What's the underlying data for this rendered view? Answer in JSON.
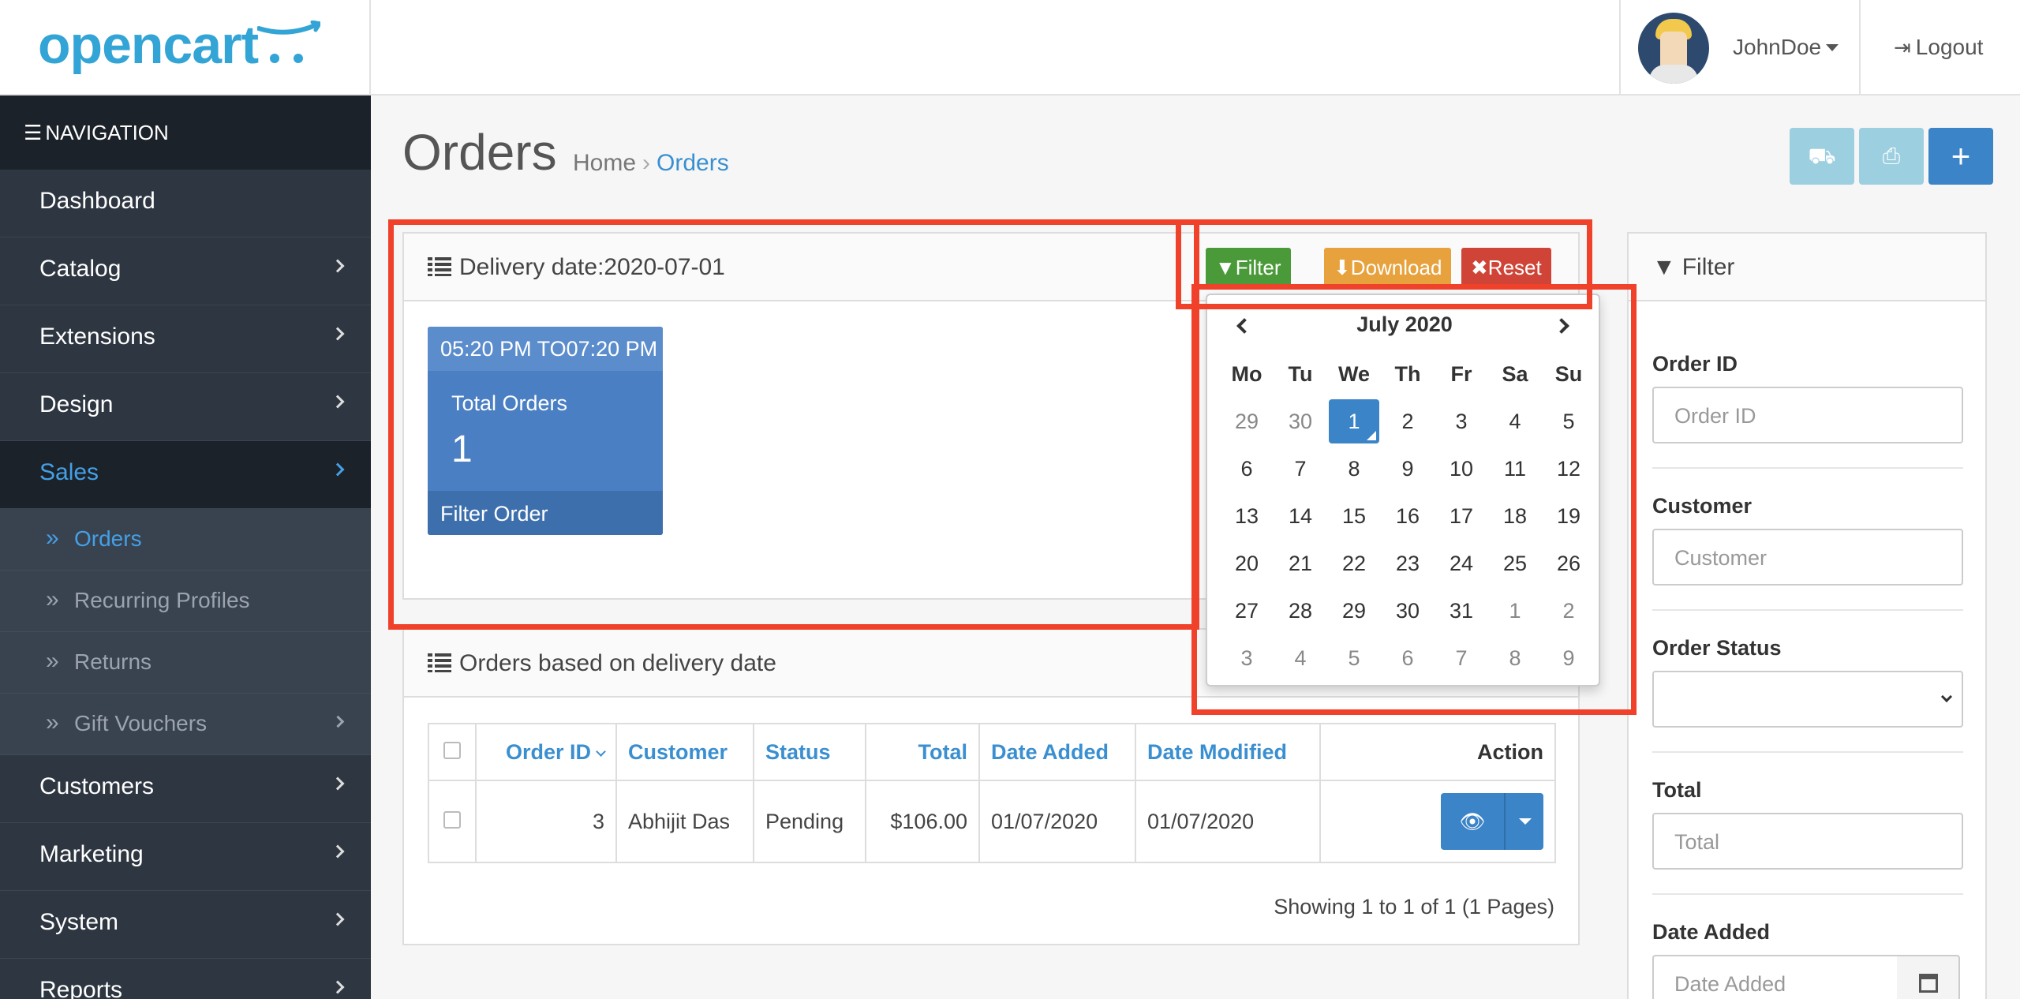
{
  "brand": {
    "logo_text": "opencart"
  },
  "user": {
    "name": "JohnDoe",
    "logout_label": "Logout"
  },
  "nav": {
    "heading": "NAVIGATION",
    "items": [
      {
        "label": "Dashboard"
      },
      {
        "label": "Catalog"
      },
      {
        "label": "Extensions"
      },
      {
        "label": "Design"
      },
      {
        "label": "Sales"
      }
    ],
    "sales_sub": [
      {
        "label": "Orders"
      },
      {
        "label": "Recurring Profiles"
      },
      {
        "label": "Returns"
      },
      {
        "label": "Gift Vouchers"
      }
    ],
    "items_after": [
      {
        "label": "Customers"
      },
      {
        "label": "Marketing"
      },
      {
        "label": "System"
      },
      {
        "label": "Reports"
      }
    ]
  },
  "page": {
    "title": "Orders",
    "breadcrumb": [
      "Home",
      "Orders"
    ]
  },
  "delivery_panel": {
    "title": "Delivery date:2020-07-01",
    "filter_label": "Filter",
    "download_label": "Download",
    "reset_label": "Reset",
    "card": {
      "time_range": "05:20 PM TO07:20 PM",
      "label": "Total Orders",
      "count": "1",
      "footer": "Filter Order"
    }
  },
  "datepicker": {
    "title": "July 2020",
    "weekdays": [
      "Mo",
      "Tu",
      "We",
      "Th",
      "Fr",
      "Sa",
      "Su"
    ],
    "weeks": [
      [
        "29",
        "30",
        "1",
        "2",
        "3",
        "4",
        "5"
      ],
      [
        "6",
        "7",
        "8",
        "9",
        "10",
        "11",
        "12"
      ],
      [
        "13",
        "14",
        "15",
        "16",
        "17",
        "18",
        "19"
      ],
      [
        "20",
        "21",
        "22",
        "23",
        "24",
        "25",
        "26"
      ],
      [
        "27",
        "28",
        "29",
        "30",
        "31",
        "1",
        "2"
      ],
      [
        "3",
        "4",
        "5",
        "6",
        "7",
        "8",
        "9"
      ]
    ],
    "selected": "1"
  },
  "orders_panel": {
    "title": "Orders based on delivery date",
    "columns": {
      "order_id": "Order ID",
      "customer": "Customer",
      "status": "Status",
      "total": "Total",
      "date_added": "Date Added",
      "date_modified": "Date Modified",
      "action": "Action"
    },
    "rows": [
      {
        "order_id": "3",
        "customer": "Abhijit Das",
        "status": "Pending",
        "total": "$106.00",
        "date_added": "01/07/2020",
        "date_modified": "01/07/2020"
      }
    ],
    "pagination": "Showing 1 to 1 of 1 (1 Pages)"
  },
  "filter_panel": {
    "title": "Filter",
    "order_id": {
      "label": "Order ID",
      "placeholder": "Order ID"
    },
    "customer": {
      "label": "Customer",
      "placeholder": "Customer"
    },
    "order_status": {
      "label": "Order Status",
      "value": ""
    },
    "total": {
      "label": "Total",
      "placeholder": "Total"
    },
    "date_added": {
      "label": "Date Added",
      "placeholder": "Date Added"
    }
  },
  "colors": {
    "accent_blue": "#3c84c8",
    "sidebar_bg": "#2e3641",
    "filter_green": "#4b9a3a",
    "download_orange": "#e7a23d",
    "reset_red": "#cf4436",
    "highlight_red": "#f0412b",
    "logo_blue": "#33a4d6"
  },
  "icons": {
    "menu": "bars-icon",
    "logout": "sign-out-icon",
    "shipping": "truck-icon",
    "print": "print-icon",
    "add": "plus-icon",
    "list": "list-icon",
    "filter": "filter-icon",
    "download": "download-icon",
    "reset": "times-icon",
    "view": "eye-icon",
    "calendar": "calendar-icon"
  }
}
